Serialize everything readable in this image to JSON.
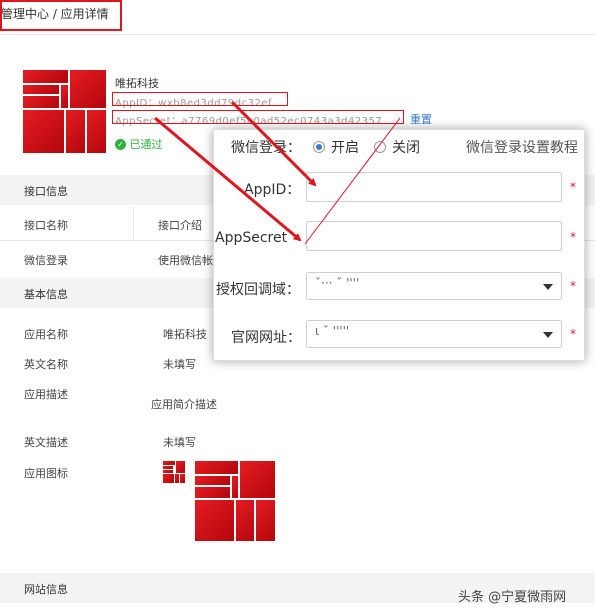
{
  "breadcrumb": {
    "text": "管理中心 / 应用详情"
  },
  "app": {
    "name": "唯拓科技",
    "appid_line": "AppID：wxb8ed3dd79dc32ef",
    "appsecret_line": "AppSecret：a7769d0ef5a0ad52ec0743a3d42357",
    "reset_label": "重置",
    "status_label": "已通过",
    "status_color": "#2cb33d"
  },
  "sections": {
    "interface": "接口信息",
    "basic": "基本信息",
    "website": "网站信息"
  },
  "interface_table": {
    "headers": [
      "接口名称",
      "接口介绍"
    ],
    "rows": [
      {
        "name": "微信登录",
        "desc": "使用微信帐"
      }
    ]
  },
  "basic_info": {
    "app_name_label": "应用名称",
    "app_name_value": "唯拓科技",
    "en_name_label": "英文名称",
    "en_name_value": "未填写",
    "desc_label": "应用描述",
    "desc_value": "应用简介描述",
    "en_desc_label": "英文描述",
    "en_desc_value": "未填写",
    "icon_label": "应用图标"
  },
  "popup": {
    "wechat_login_label": "微信登录：",
    "radio_on_label": "开启",
    "radio_off_label": "关闭",
    "tutorial_link": "微信登录设置教程",
    "appid_label": "AppID：",
    "appsecret_label": "AppSecret",
    "callback_label": "授权回调域：",
    "website_label": "官网网址：",
    "callback_value": "ˇ··· ˇ ''''",
    "website_value": "ι          ˇ '''''",
    "required_mark": "*"
  },
  "watermark": "头条 @宁夏微雨网",
  "colors": {
    "accent_red": "#e0161f",
    "logo_red": "#c8090f"
  }
}
